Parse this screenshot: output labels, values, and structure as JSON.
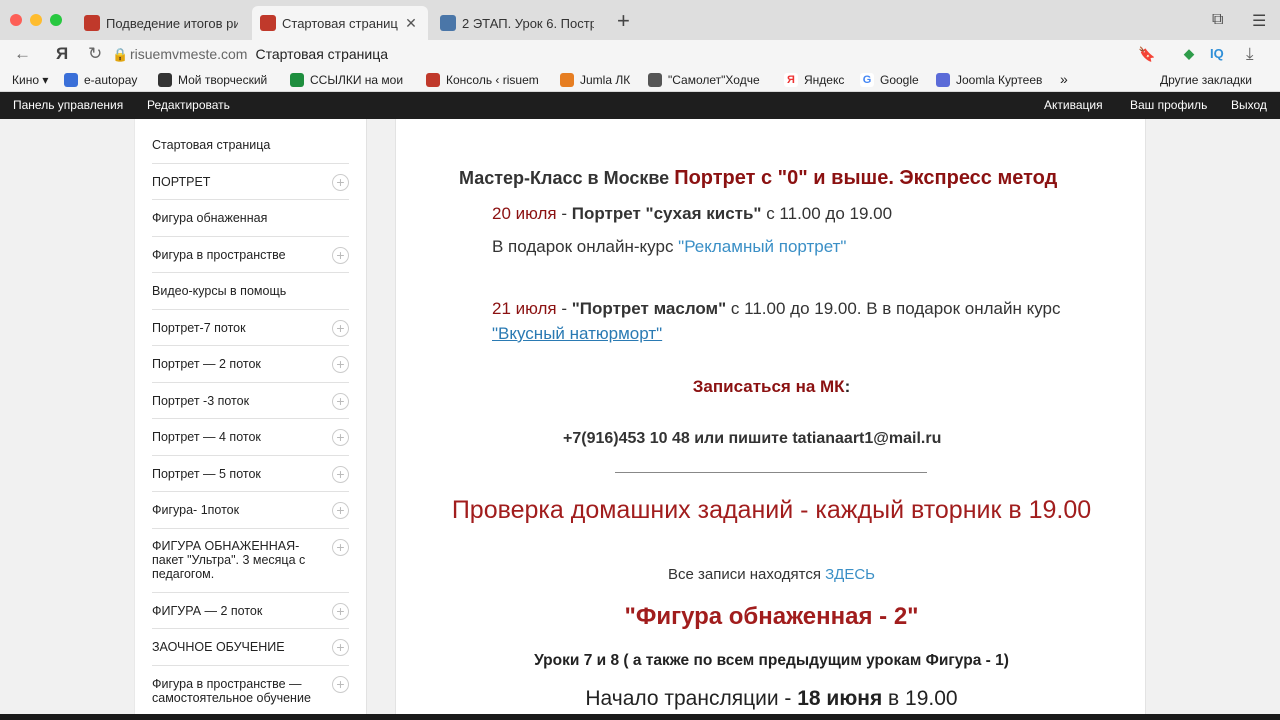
{
  "browser": {
    "tabs": [
      {
        "title": "Подведение итогов рисо",
        "favicon_color": "#c0392b"
      },
      {
        "title": "Стартовая страница",
        "favicon_color": "#c0392b"
      },
      {
        "title": "2 ЭТАП. Урок 6. Построе",
        "favicon_color": "#4a76a8"
      }
    ],
    "url_host": "risuemvmeste.com",
    "url_page_title": "Стартовая страница",
    "ext_iq": "IQ",
    "bookmarks": [
      "Кино ▾",
      "e-autopay",
      "Мой творческий",
      "ССЫЛКИ на мои",
      "Консоль ‹ risuem",
      "Jumla ЛК",
      "\"Самолет\"Ходче",
      "Яндекс",
      "Google",
      "Joomla Куртеев"
    ],
    "bookmarks_more": "»",
    "other_bookmarks": "Другие закладки"
  },
  "adminbar": {
    "dashboard": "Панель управления",
    "edit": "Редактировать",
    "activation": "Активация",
    "profile": "Ваш профиль",
    "logout": "Выход"
  },
  "sidebar": {
    "items": [
      {
        "label": "Стартовая страница",
        "has_plus": false
      },
      {
        "label": "ПОРТРЕТ",
        "has_plus": true
      },
      {
        "label": "Фигура обнаженная",
        "has_plus": false
      },
      {
        "label": "Фигура в пространстве",
        "has_plus": true
      },
      {
        "label": "Видео-курсы в помощь",
        "has_plus": false
      },
      {
        "label": "Портрет-7 поток",
        "has_plus": true
      },
      {
        "label": "Портрет — 2 поток",
        "has_plus": true
      },
      {
        "label": "Портрет -3 поток",
        "has_plus": true
      },
      {
        "label": "Портрет — 4 поток",
        "has_plus": true
      },
      {
        "label": "Портрет — 5 поток",
        "has_plus": true
      },
      {
        "label": "Фигура- 1поток",
        "has_plus": true
      },
      {
        "label": "ФИГУРА ОБНАЖЕННАЯ-пакет \"Ультра\". 3 месяца с педагогом.",
        "has_plus": true
      },
      {
        "label": "ФИГУРА — 2 поток",
        "has_plus": true
      },
      {
        "label": "ЗАОЧНОЕ ОБУЧЕНИЕ",
        "has_plus": true
      },
      {
        "label": "Фигура в пространстве — самостоятельное обучение",
        "has_plus": true
      }
    ]
  },
  "content": {
    "mk_prefix": "Мастер-Класс в Москве",
    "mk_title": "Портрет с \"0\" и выше. Экспресс метод",
    "ev1_date": "20 июля",
    "ev1_dash": " - ",
    "ev1_name": "Портрет \"сухая кисть\"",
    "ev1_time": " с 11.00 до 19.00",
    "gift1_text": "В подарок онлайн-курс ",
    "gift1_link": "\"Рекламный портрет\"",
    "ev2_date": "21 июля",
    "ev2_dash": " - ",
    "ev2_name": "\"Портрет маслом\"",
    "ev2_time": " с 11.00 до 19.00. В в подарок онлайн курс",
    "gift2_link": "\"Вкусный натюрморт\"",
    "signup": "Записаться на МК",
    "signup_colon": ":",
    "contact": "+7(916)453 10 48 или пишите  tatianaart1@mail.ru",
    "hw_check": "Проверка домашних заданий - каждый вторник в 19.00",
    "records_text": "Все записи находятся ",
    "records_link": "ЗДЕСЬ",
    "figure2": "\"Фигура обнаженная - 2\"",
    "lessons": "Уроки 7 и 8 ( а также по всем предыдущим урокам Фигура - 1)",
    "broadcast_prefix": "Начало трансляции - ",
    "broadcast_date": "18 июня",
    "broadcast_time": "  в 19.00"
  }
}
